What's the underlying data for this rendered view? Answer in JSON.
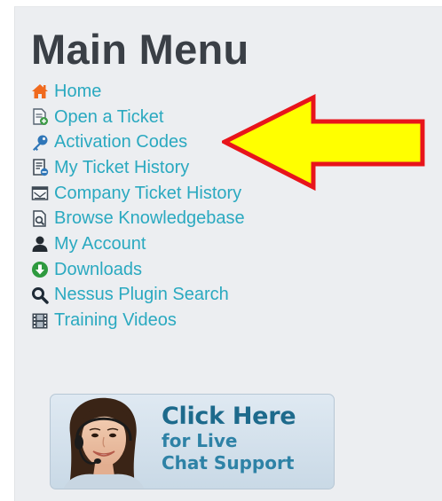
{
  "main_menu": {
    "title": "Main Menu",
    "items": [
      {
        "label": "Home",
        "icon": "home-icon"
      },
      {
        "label": "Open a Ticket",
        "icon": "open-ticket-icon"
      },
      {
        "label": "Activation Codes",
        "icon": "key-icon"
      },
      {
        "label": "My Ticket History",
        "icon": "ticket-history-icon"
      },
      {
        "label": "Company Ticket History",
        "icon": "company-history-icon"
      },
      {
        "label": "Browse Knowledgebase",
        "icon": "knowledgebase-icon"
      },
      {
        "label": "My Account",
        "icon": "user-icon"
      },
      {
        "label": "Downloads",
        "icon": "download-icon"
      },
      {
        "label": "Nessus Plugin Search",
        "icon": "search-icon"
      },
      {
        "label": "Training Videos",
        "icon": "film-icon"
      }
    ]
  },
  "chat_banner": {
    "line1": "Click Here",
    "line2": "for Live",
    "line3": "Chat Support"
  },
  "colors": {
    "link": "#2aa9c0",
    "title": "#3a3f46",
    "arrow_fill": "#ffff00",
    "arrow_stroke": "#e8141b",
    "panel_bg": "#eceef1"
  }
}
